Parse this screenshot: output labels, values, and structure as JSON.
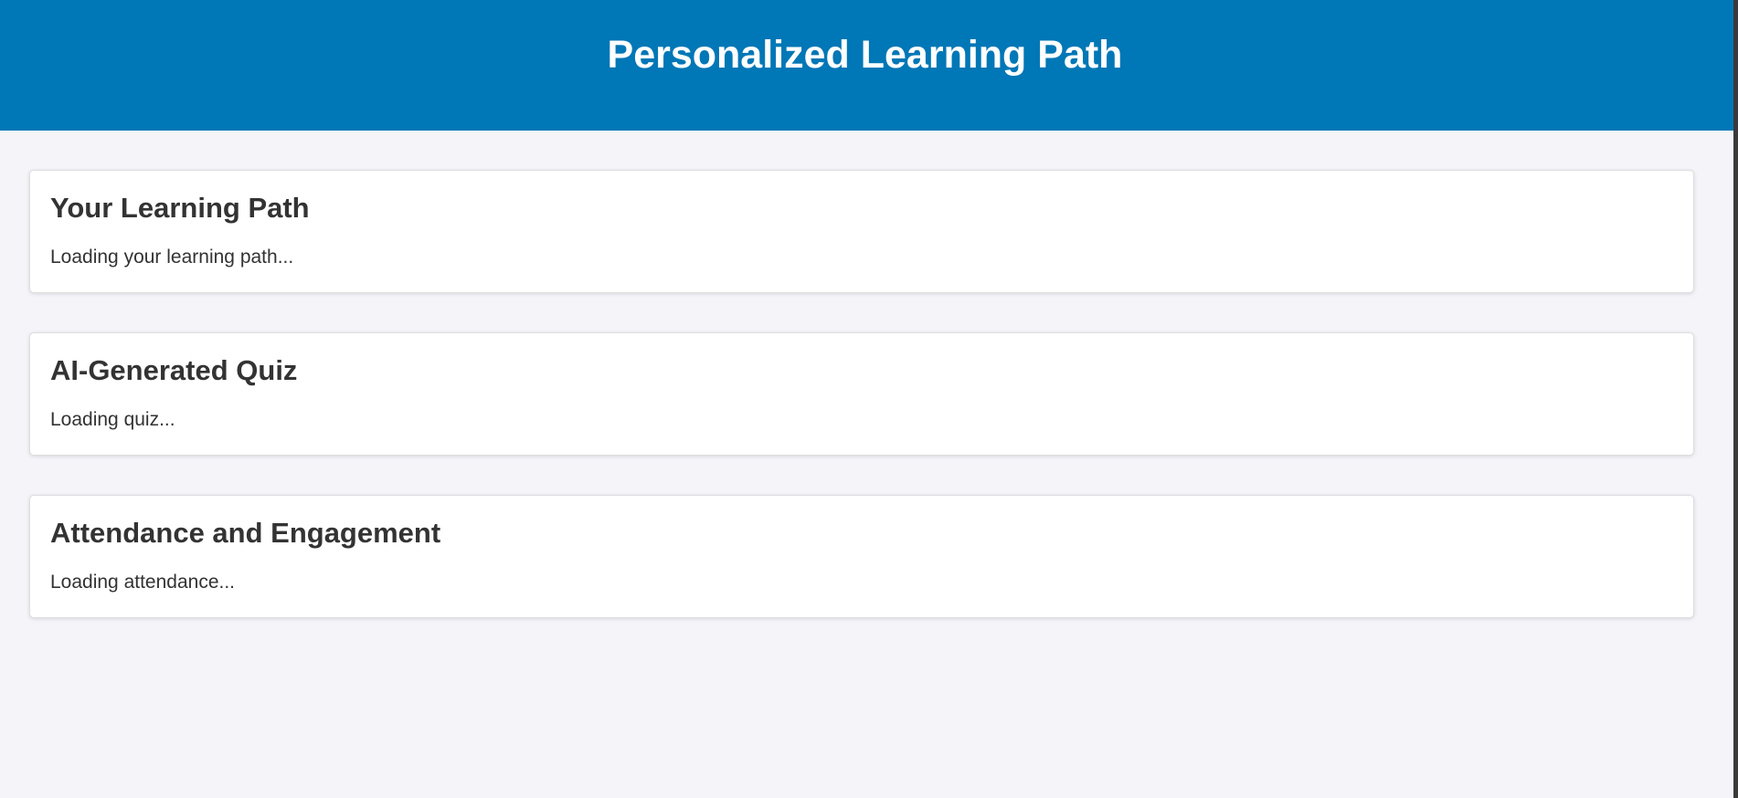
{
  "header": {
    "title": "Personalized Learning Path"
  },
  "sections": [
    {
      "title": "Your Learning Path",
      "status": "Loading your learning path..."
    },
    {
      "title": "AI-Generated Quiz",
      "status": "Loading quiz..."
    },
    {
      "title": "Attendance and Engagement",
      "status": "Loading attendance..."
    }
  ],
  "colors": {
    "header_bg": "#0077b6",
    "page_bg": "#f4f4f9",
    "card_bg": "#ffffff",
    "text": "#333333"
  }
}
